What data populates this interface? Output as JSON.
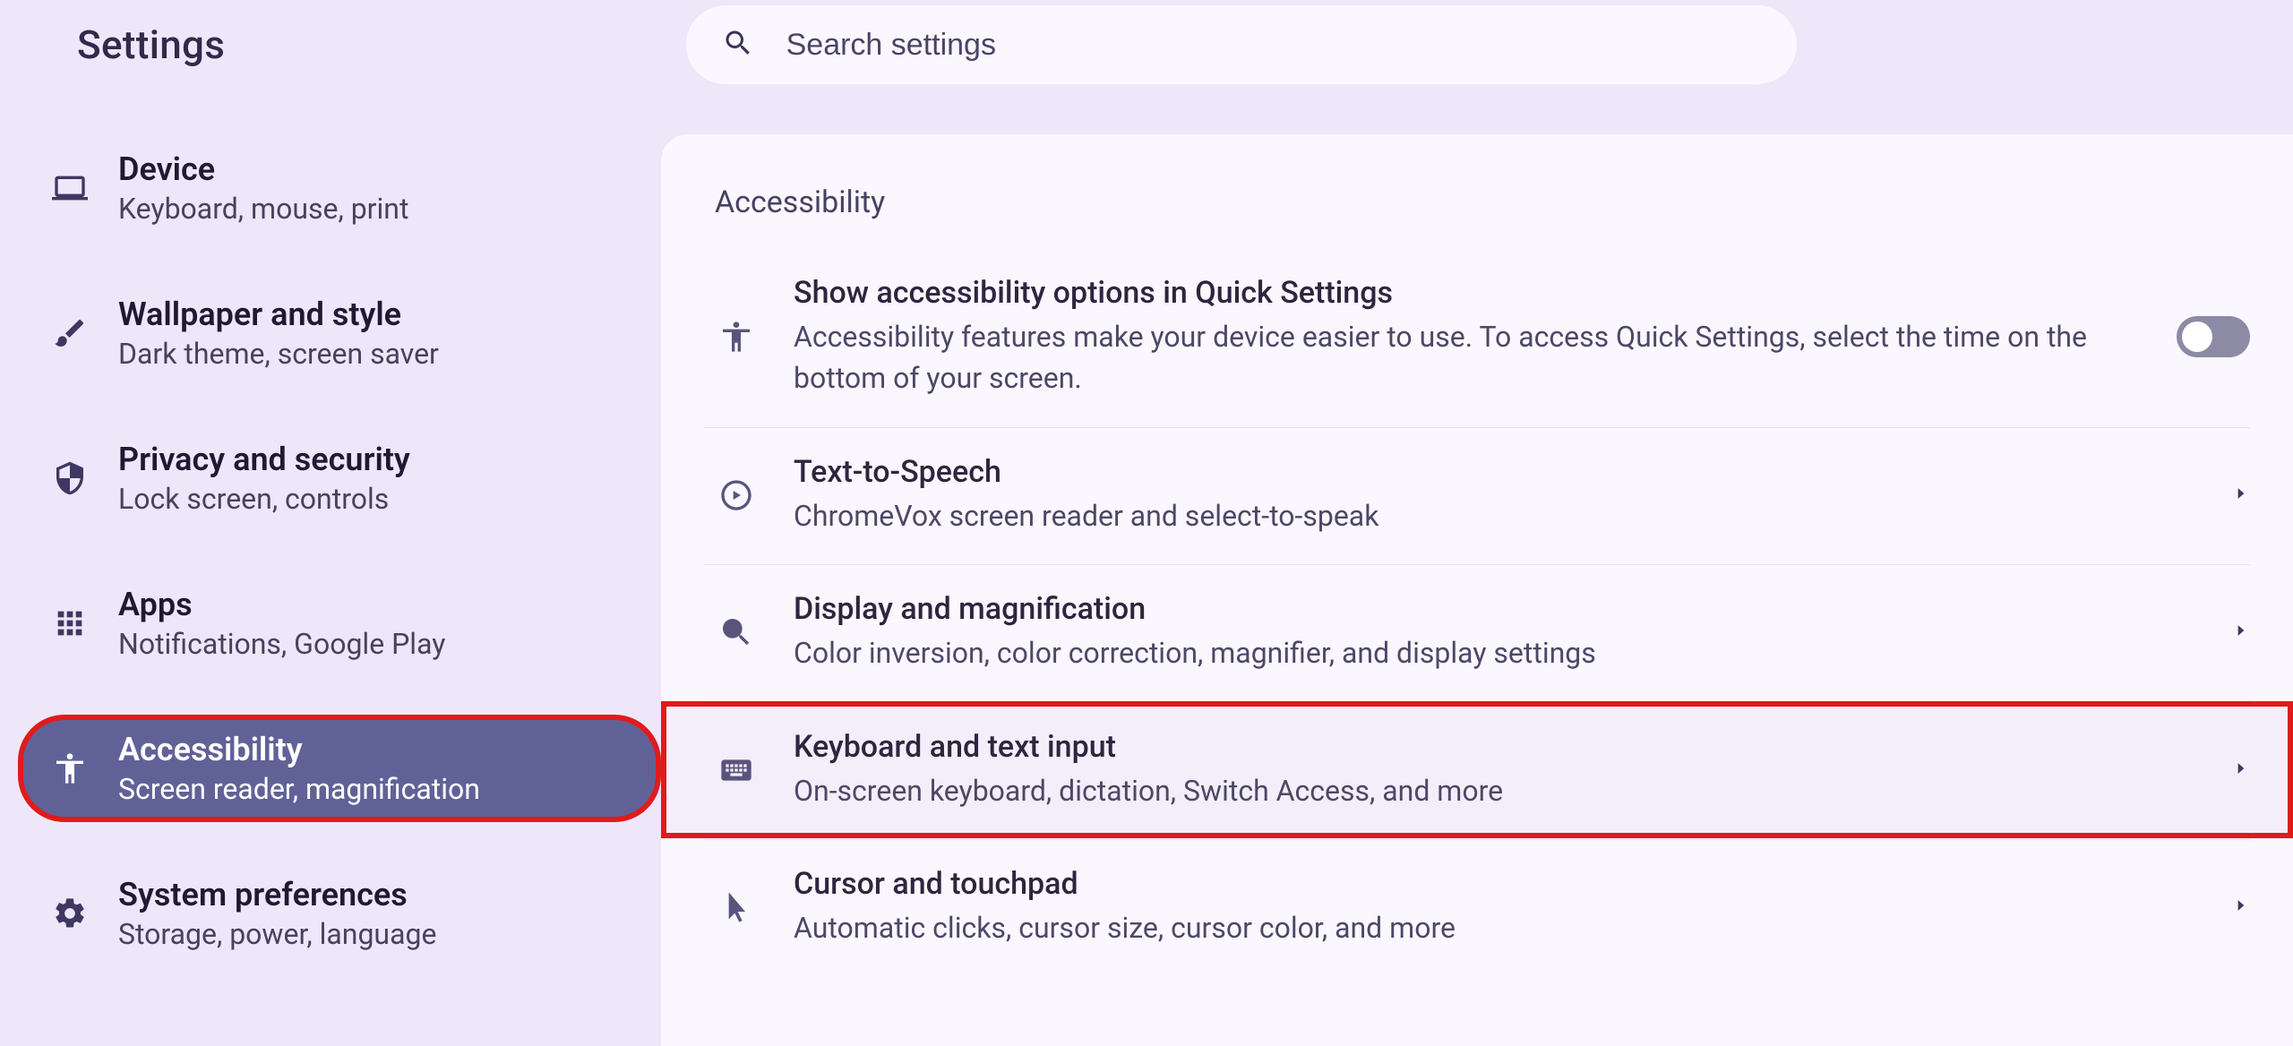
{
  "header": {
    "title": "Settings",
    "search_placeholder": "Search settings"
  },
  "sidebar": {
    "items": [
      {
        "id": "device",
        "title": "Device",
        "sub": "Keyboard, mouse, print",
        "icon": "laptop-icon",
        "active": false
      },
      {
        "id": "wallpaper",
        "title": "Wallpaper and style",
        "sub": "Dark theme, screen saver",
        "icon": "brush-icon",
        "active": false
      },
      {
        "id": "privacy",
        "title": "Privacy and security",
        "sub": "Lock screen, controls",
        "icon": "shield-icon",
        "active": false
      },
      {
        "id": "apps",
        "title": "Apps",
        "sub": "Notifications, Google Play",
        "icon": "apps-grid-icon",
        "active": false
      },
      {
        "id": "accessibility",
        "title": "Accessibility",
        "sub": "Screen reader, magnification",
        "icon": "accessibility-icon",
        "active": true,
        "highlight": true
      },
      {
        "id": "system",
        "title": "System preferences",
        "sub": "Storage, power, language",
        "icon": "gear-icon",
        "active": false
      }
    ]
  },
  "main": {
    "section_title": "Accessibility",
    "rows": [
      {
        "id": "quick-settings",
        "title": "Show accessibility options in Quick Settings",
        "sub": "Accessibility features make your device easier to use. To access Quick Settings, select the time on the bottom of your screen.",
        "icon": "accessibility-icon",
        "control": "toggle",
        "toggle_on": false
      },
      {
        "id": "tts",
        "title": "Text-to-Speech",
        "sub": "ChromeVox screen reader and select-to-speak",
        "icon": "tts-icon",
        "control": "chevron"
      },
      {
        "id": "display",
        "title": "Display and magnification",
        "sub": "Color inversion, color correction, magnifier, and display settings",
        "icon": "zoom-in-icon",
        "control": "chevron"
      },
      {
        "id": "keyboard",
        "title": "Keyboard and text input",
        "sub": "On-screen keyboard, dictation, Switch Access, and more",
        "icon": "keyboard-icon",
        "control": "chevron",
        "highlight": true
      },
      {
        "id": "cursor",
        "title": "Cursor and touchpad",
        "sub": "Automatic clicks, cursor size, cursor color, and more",
        "icon": "cursor-icon",
        "control": "chevron"
      }
    ]
  }
}
